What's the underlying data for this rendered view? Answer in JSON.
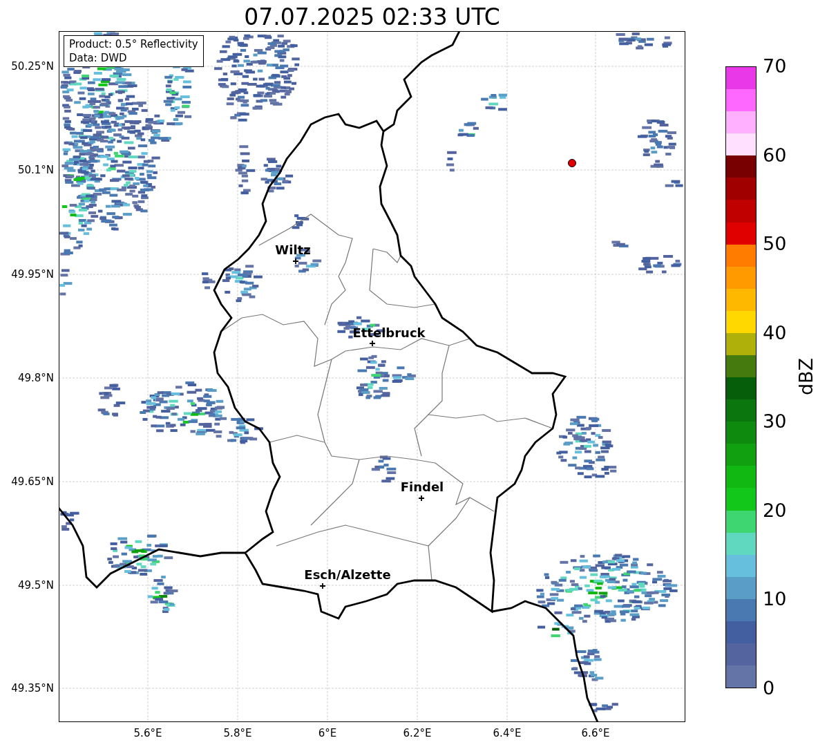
{
  "title": "07.07.2025 02:33 UTC",
  "info_box": [
    "Product: 0.5° Reflectivity",
    "Data: DWD"
  ],
  "y_ticks": [
    "50.25°N",
    "50.1°N",
    "49.95°N",
    "49.8°N",
    "49.65°N",
    "49.5°N",
    "49.35°N"
  ],
  "x_ticks": [
    "5.6°E",
    "5.8°E",
    "6°E",
    "6.2°E",
    "6.4°E",
    "6.6°E"
  ],
  "cities": [
    {
      "label": "Wiltz"
    },
    {
      "label": "Ettelbruck"
    },
    {
      "label": "Findel"
    },
    {
      "label": "Esch/Alzette"
    }
  ],
  "colorbar": {
    "label": "dBZ",
    "ticks": [
      "70",
      "60",
      "50",
      "40",
      "30",
      "20",
      "10",
      "0"
    ],
    "segments": [
      {
        "color": "#e838e8"
      },
      {
        "color": "#ff68ff"
      },
      {
        "color": "#ffb0ff"
      },
      {
        "color": "#ffe0ff"
      },
      {
        "color": "#780000"
      },
      {
        "color": "#a00000"
      },
      {
        "color": "#c00000"
      },
      {
        "color": "#e00000"
      },
      {
        "color": "#ff7c00"
      },
      {
        "color": "#ff9a00"
      },
      {
        "color": "#ffb800"
      },
      {
        "color": "#ffd800"
      },
      {
        "color": "#b0b00a"
      },
      {
        "color": "#457a0e"
      },
      {
        "color": "#075e0a"
      },
      {
        "color": "#0b760e"
      },
      {
        "color": "#0e8a0e"
      },
      {
        "color": "#10a010"
      },
      {
        "color": "#12b812"
      },
      {
        "color": "#12c71a"
      },
      {
        "color": "#3ed670"
      },
      {
        "color": "#60d8c0"
      },
      {
        "color": "#66c0dd"
      },
      {
        "color": "#5a9ec8"
      },
      {
        "color": "#4a78b0"
      },
      {
        "color": "#445f9f"
      },
      {
        "color": "#53649e"
      },
      {
        "color": "#6474a6"
      }
    ]
  }
}
